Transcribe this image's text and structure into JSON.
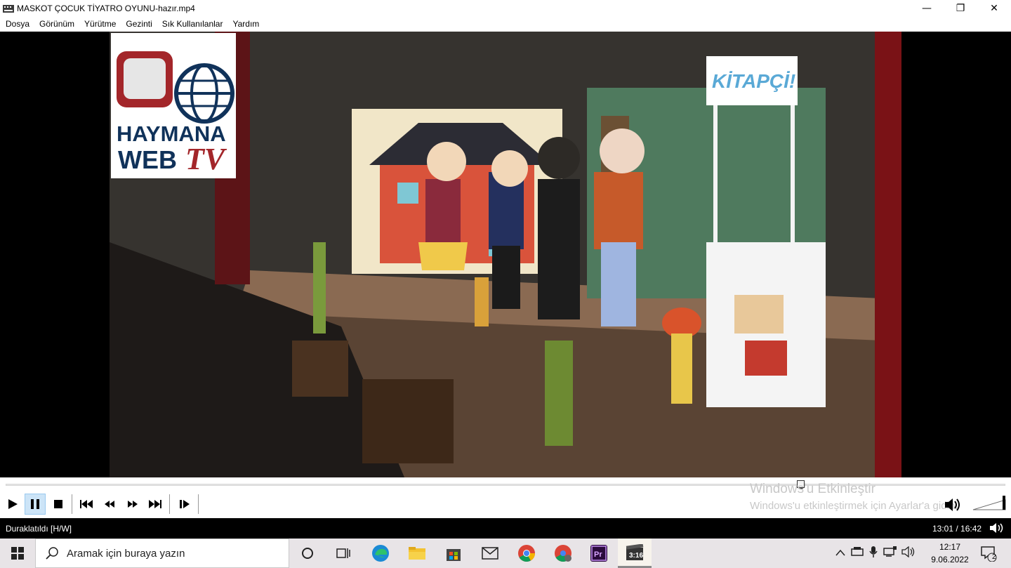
{
  "window": {
    "title": "MASKOT ÇOCUK TİYATRO OYUNU-hazır.mp4",
    "minimize_glyph": "—",
    "maximize_glyph": "❐",
    "close_glyph": "✕"
  },
  "menu": [
    "Dosya",
    "Görünüm",
    "Yürütme",
    "Gezinti",
    "Sık Kullanılanlar",
    "Yardım"
  ],
  "video": {
    "logo_line1": "HAYMANA",
    "logo_line2": "WEB",
    "logo_line3": "TV",
    "stand_sign": "KİTAPÇİ!"
  },
  "playback": {
    "progress": 0.795,
    "state": "paused",
    "volume_icon": "speaker-on-icon"
  },
  "activation": {
    "title": "Windows'u Etkinleştir",
    "subtitle": "Windows'u etkinleştirmek için Ayarlar'a gidin."
  },
  "status": {
    "left": "Duraklatıldı [H/W]",
    "time": "13:01 / 16:42"
  },
  "taskbar": {
    "search_placeholder": "Aramak için buraya yazın",
    "clock_time": "12:17",
    "clock_date": "9.06.2022",
    "notification_count": "2"
  },
  "colors": {
    "accent_active": "#cce4f7",
    "status_bg": "#000000",
    "taskbar_bg": "#e8e4e7"
  }
}
